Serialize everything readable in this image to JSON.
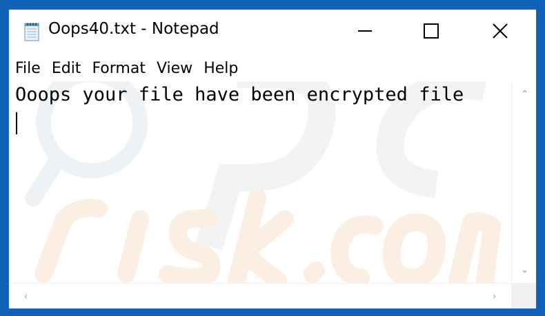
{
  "window": {
    "title": "Oops40.txt - Notepad",
    "icon": "notepad-icon",
    "frame_color": "#0f62b8"
  },
  "controls": {
    "minimize_icon": "minimize-icon",
    "maximize_icon": "maximize-icon",
    "close_icon": "close-icon"
  },
  "menu": {
    "items": [
      {
        "label": "File"
      },
      {
        "label": "Edit"
      },
      {
        "label": "Format"
      },
      {
        "label": "View"
      },
      {
        "label": "Help"
      }
    ]
  },
  "editor": {
    "content": "Ooops your file have been encrypted file"
  },
  "scrollbars": {
    "up_arrow": "⌃",
    "down_arrow": "⌄",
    "left_arrow": "‹",
    "right_arrow": "›"
  }
}
